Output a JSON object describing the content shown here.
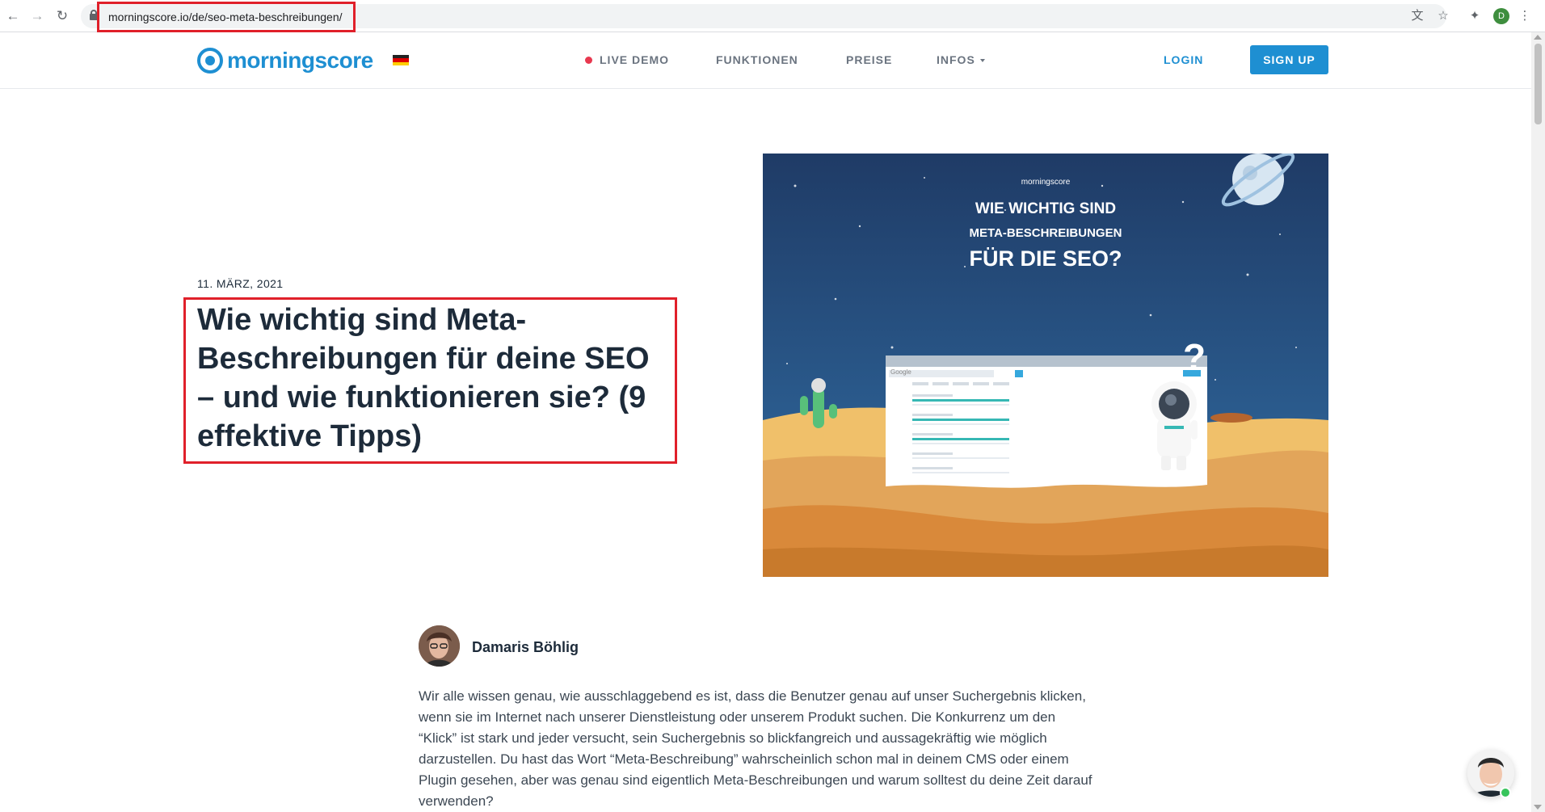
{
  "browser": {
    "url": "morningscore.io/de/seo-meta-beschreibungen/",
    "profile_initial": "D"
  },
  "header": {
    "logo_text": "morningscore",
    "nav": {
      "live_demo": "LIVE DEMO",
      "funktionen": "FUNKTIONEN",
      "preise": "PREISE",
      "infos": "INFOS"
    },
    "login": "LOGIN",
    "signup": "SIGN UP"
  },
  "post": {
    "date": "11. MÄRZ, 2021",
    "title": "Wie wichtig sind Meta-Beschreibungen für deine SEO – und wie funktionieren sie? (9 effektive Tipps)"
  },
  "hero_image": {
    "brand": "morningscore",
    "line1": "WIE WICHTIG SIND",
    "line2": "META-BESCHREIBUNGEN",
    "line3": "FÜR DIE SEO?",
    "search_brand": "Google"
  },
  "author": {
    "name": "Damaris Böhlig"
  },
  "article": {
    "intro": "Wir alle wissen genau, wie ausschlaggebend es ist, dass die Benutzer genau auf unser Suchergebnis klicken, wenn sie im Internet nach unserer Dienstleistung oder unserem Produkt suchen. Die Konkurrenz um den “Klick” ist stark und jeder versucht, sein Suchergebnis so blickfangreich und aussagekräftig wie möglich darzustellen. Du hast das Wort “Meta-Beschreibung” wahrscheinlich schon mal in deinem CMS oder einem Plugin gesehen, aber was genau sind eigentlich Meta-Beschreibungen und warum solltest du deine Zeit darauf verwenden?"
  },
  "colors": {
    "brand_blue": "#1e8fd2",
    "live_red": "#e8384f",
    "highlight_red": "#e0202a"
  }
}
